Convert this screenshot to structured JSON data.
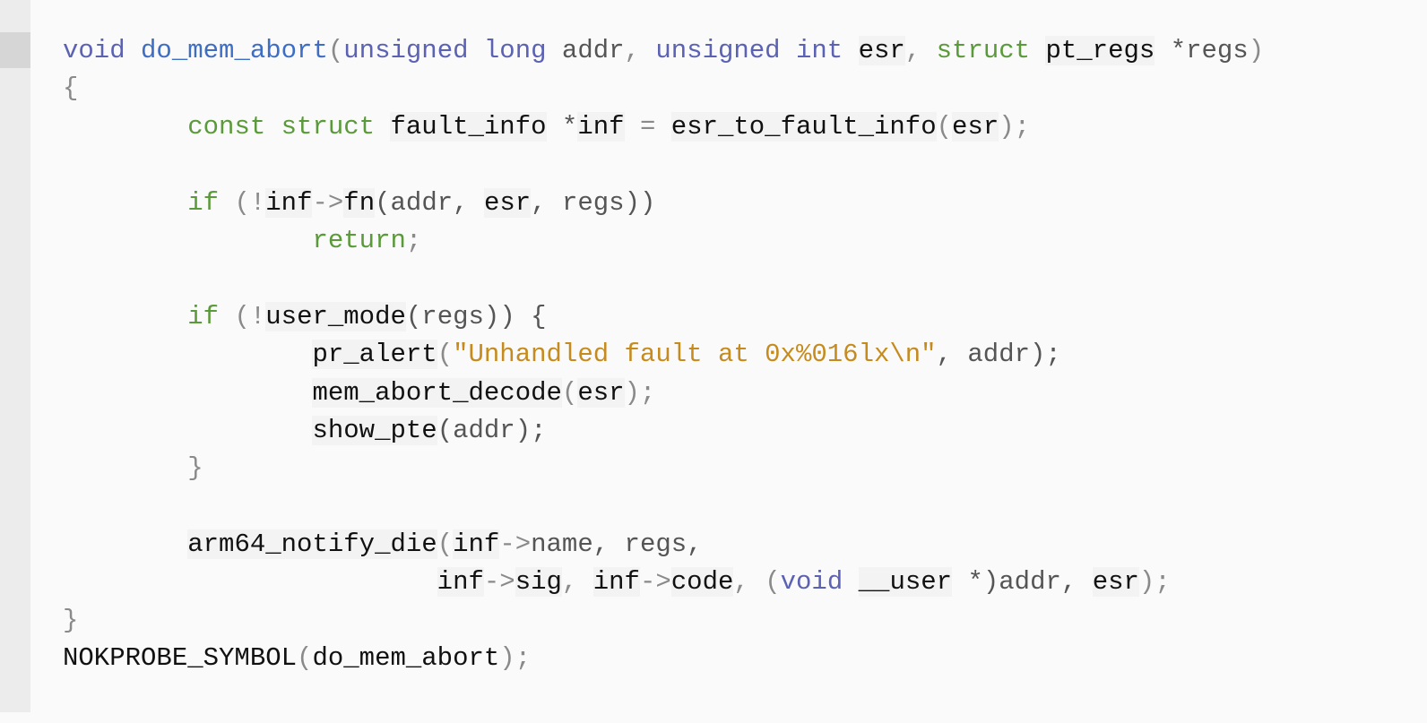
{
  "code_lines": [
    [
      {
        "t": "void",
        "c": "type"
      },
      {
        "t": " ",
        "c": "pl"
      },
      {
        "t": "do_mem_abort",
        "c": "fn"
      },
      {
        "t": "(",
        "c": "pun"
      },
      {
        "t": "unsigned long",
        "c": "type"
      },
      {
        "t": " addr",
        "c": "pl"
      },
      {
        "t": ", ",
        "c": "pun"
      },
      {
        "t": "unsigned int",
        "c": "type"
      },
      {
        "t": " ",
        "c": "pl"
      },
      {
        "t": "esr",
        "c": "id"
      },
      {
        "t": ", ",
        "c": "pun"
      },
      {
        "t": "struct",
        "c": "kw"
      },
      {
        "t": " ",
        "c": "pl"
      },
      {
        "t": "pt_regs",
        "c": "id"
      },
      {
        "t": " *regs",
        "c": "pl"
      },
      {
        "t": ")",
        "c": "pun"
      }
    ],
    [
      {
        "t": "{",
        "c": "pun"
      }
    ],
    [
      {
        "t": "        ",
        "c": "pl"
      },
      {
        "t": "const struct",
        "c": "kw"
      },
      {
        "t": " ",
        "c": "pl"
      },
      {
        "t": "fault_info",
        "c": "id"
      },
      {
        "t": " *",
        "c": "pl"
      },
      {
        "t": "inf",
        "c": "id"
      },
      {
        "t": " = ",
        "c": "pun"
      },
      {
        "t": "esr_to_fault_info",
        "c": "id"
      },
      {
        "t": "(",
        "c": "pun"
      },
      {
        "t": "esr",
        "c": "id"
      },
      {
        "t": ");",
        "c": "pun"
      }
    ],
    [],
    [
      {
        "t": "        ",
        "c": "pl"
      },
      {
        "t": "if",
        "c": "kw"
      },
      {
        "t": " (!",
        "c": "pun"
      },
      {
        "t": "inf",
        "c": "id"
      },
      {
        "t": "->",
        "c": "pun"
      },
      {
        "t": "fn",
        "c": "id"
      },
      {
        "t": "(addr, ",
        "c": "pl"
      },
      {
        "t": "esr",
        "c": "id"
      },
      {
        "t": ", regs))",
        "c": "pl"
      }
    ],
    [
      {
        "t": "                ",
        "c": "pl"
      },
      {
        "t": "return",
        "c": "kw"
      },
      {
        "t": ";",
        "c": "pun"
      }
    ],
    [],
    [
      {
        "t": "        ",
        "c": "pl"
      },
      {
        "t": "if",
        "c": "kw"
      },
      {
        "t": " (!",
        "c": "pun"
      },
      {
        "t": "user_mode",
        "c": "id"
      },
      {
        "t": "(regs)) {",
        "c": "pl"
      }
    ],
    [
      {
        "t": "                ",
        "c": "pl"
      },
      {
        "t": "pr_alert",
        "c": "id"
      },
      {
        "t": "(",
        "c": "pun"
      },
      {
        "t": "\"Unhandled fault at 0x%016lx\\n\"",
        "c": "str"
      },
      {
        "t": ", addr);",
        "c": "pl"
      }
    ],
    [
      {
        "t": "                ",
        "c": "pl"
      },
      {
        "t": "mem_abort_decode",
        "c": "id"
      },
      {
        "t": "(",
        "c": "pun"
      },
      {
        "t": "esr",
        "c": "id"
      },
      {
        "t": ");",
        "c": "pun"
      }
    ],
    [
      {
        "t": "                ",
        "c": "pl"
      },
      {
        "t": "show_pte",
        "c": "id"
      },
      {
        "t": "(addr);",
        "c": "pl"
      }
    ],
    [
      {
        "t": "        ",
        "c": "pl"
      },
      {
        "t": "}",
        "c": "pun"
      }
    ],
    [],
    [
      {
        "t": "        ",
        "c": "pl"
      },
      {
        "t": "arm64_notify_die",
        "c": "id"
      },
      {
        "t": "(",
        "c": "pun"
      },
      {
        "t": "inf",
        "c": "id"
      },
      {
        "t": "->",
        "c": "pun"
      },
      {
        "t": "name, regs,",
        "c": "pl"
      }
    ],
    [
      {
        "t": "                        ",
        "c": "pl"
      },
      {
        "t": "inf",
        "c": "id"
      },
      {
        "t": "->",
        "c": "pun"
      },
      {
        "t": "sig",
        "c": "id"
      },
      {
        "t": ", ",
        "c": "pun"
      },
      {
        "t": "inf",
        "c": "id"
      },
      {
        "t": "->",
        "c": "pun"
      },
      {
        "t": "code",
        "c": "id"
      },
      {
        "t": ", (",
        "c": "pun"
      },
      {
        "t": "void",
        "c": "type"
      },
      {
        "t": " ",
        "c": "pl"
      },
      {
        "t": "__user",
        "c": "id"
      },
      {
        "t": " *)addr, ",
        "c": "pl"
      },
      {
        "t": "esr",
        "c": "id"
      },
      {
        "t": ");",
        "c": "pun"
      }
    ],
    [
      {
        "t": "}",
        "c": "pun"
      }
    ],
    [
      {
        "t": "NOKPROBE_SYMBOL",
        "c": "mac"
      },
      {
        "t": "(",
        "c": "pun"
      },
      {
        "t": "do_mem_abort",
        "c": "mac"
      },
      {
        "t": ");",
        "c": "pun"
      }
    ]
  ]
}
